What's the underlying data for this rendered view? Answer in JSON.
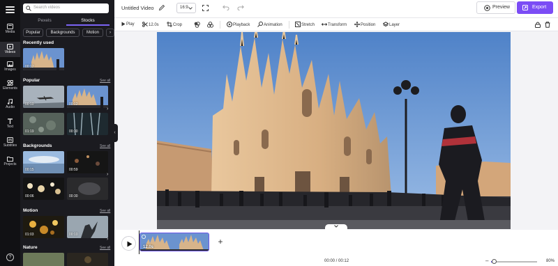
{
  "sidebar": {
    "items": [
      {
        "label": "Media",
        "icon": "media-icon"
      },
      {
        "label": "Videos",
        "icon": "video-icon"
      },
      {
        "label": "Images",
        "icon": "image-icon"
      },
      {
        "label": "Elements",
        "icon": "elements-icon"
      },
      {
        "label": "Audio",
        "icon": "music-icon"
      },
      {
        "label": "Text",
        "icon": "text-icon"
      },
      {
        "label": "Subtitles",
        "icon": "subtitles-icon"
      },
      {
        "label": "Projects",
        "icon": "folder-icon"
      }
    ],
    "active": "Videos"
  },
  "media_panel": {
    "search_placeholder": "Search videos",
    "source_tabs": [
      "Pexels",
      "Stocks"
    ],
    "active_source": "Stocks",
    "chips": [
      "Popular",
      "Backgrounds",
      "Motion"
    ],
    "see_all": "See all",
    "sections": [
      {
        "title": "Recently used",
        "items": [
          {
            "duration": "00:12"
          }
        ]
      },
      {
        "title": "Popular",
        "items": [
          {
            "duration": "00:10"
          },
          {
            "duration": "00:12"
          },
          {
            "duration": "01:19"
          },
          {
            "duration": "00:30"
          }
        ]
      },
      {
        "title": "Backgrounds",
        "items": [
          {
            "duration": "00:15"
          },
          {
            "duration": "00:59"
          },
          {
            "duration": "00:06"
          },
          {
            "duration": "00:30"
          }
        ]
      },
      {
        "title": "Motion",
        "items": [
          {
            "duration": "01:03"
          },
          {
            "duration": "00:10"
          }
        ]
      },
      {
        "title": "Nature",
        "items": []
      }
    ]
  },
  "topbar": {
    "title": "Untitled Video",
    "aspect_ratio": "16:9",
    "preview_label": "Preview",
    "export_label": "Export"
  },
  "toolbar": {
    "play": "Play",
    "duration": "12.0s",
    "crop": "Crop",
    "playback": "Playback",
    "animation": "Animation",
    "stretch": "Stretch",
    "transform": "Transform",
    "position": "Position",
    "layer": "Layer"
  },
  "timeline": {
    "clip_duration": "12.0s",
    "time_display": "00:00 / 00:12",
    "zoom": "80%"
  },
  "colors": {
    "accent": "#7b4cf5",
    "rail_bg": "#111114",
    "panel_bg": "#1b1b20"
  }
}
